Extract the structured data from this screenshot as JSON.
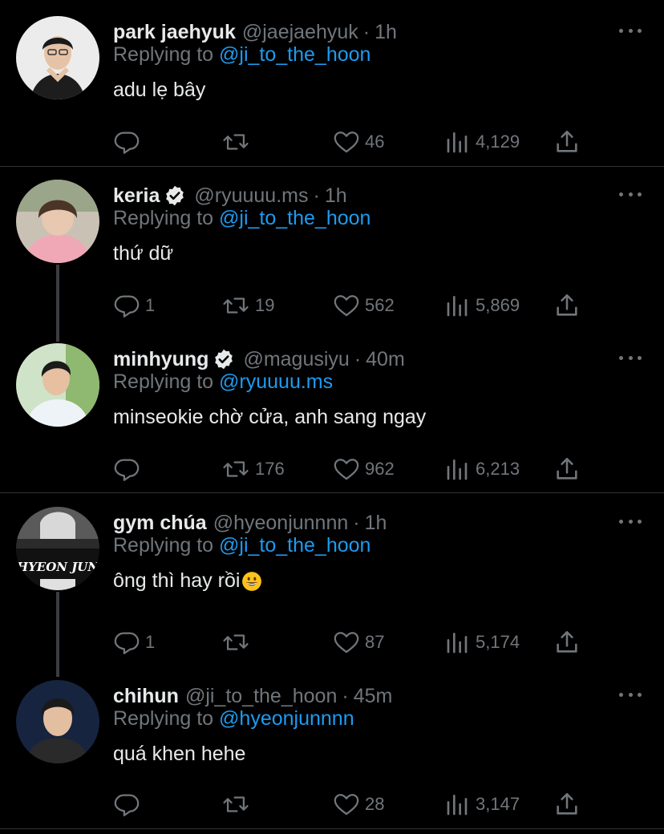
{
  "tweets": [
    {
      "name": "park jaehyuk",
      "verified": false,
      "handle": "@jaejaehyuk",
      "time": "1h",
      "replying_prefix": "Replying to",
      "replying_to": "@ji_to_the_hoon",
      "text": "adu lẹ bây",
      "replies": "",
      "retweets": "",
      "likes": "46",
      "views": "4,129"
    },
    {
      "name": "keria",
      "verified": true,
      "handle": "@ryuuuu.ms",
      "time": "1h",
      "replying_prefix": "Replying to",
      "replying_to": "@ji_to_the_hoon",
      "text": "thứ dữ",
      "replies": "1",
      "retweets": "19",
      "likes": "562",
      "views": "5,869"
    },
    {
      "name": "minhyung",
      "verified": true,
      "handle": "@magusiyu",
      "time": "40m",
      "replying_prefix": "Replying to",
      "replying_to": "@ryuuuu.ms",
      "text": "minseokie chờ cửa, anh sang ngay",
      "replies": "",
      "retweets": "176",
      "likes": "962",
      "views": "6,213"
    },
    {
      "name": "gym chúa",
      "verified": false,
      "handle": "@hyeonjunnnn",
      "time": "1h",
      "replying_prefix": "Replying to",
      "replying_to": "@ji_to_the_hoon",
      "text": "ông thì hay rồi",
      "replies": "1",
      "retweets": "",
      "likes": "87",
      "views": "5,174"
    },
    {
      "name": "chihun",
      "verified": false,
      "handle": "@ji_to_the_hoon",
      "time": "45m",
      "replying_prefix": "Replying to",
      "replying_to": "@hyeonjunnnn",
      "text": "quá khen hehe",
      "replies": "",
      "retweets": "",
      "likes": "28",
      "views": "3,147"
    }
  ],
  "separator": "·",
  "avatar4_text": "HYEON JUN",
  "colors": {
    "accent": "#1d9bf0",
    "muted": "#71767b",
    "text": "#e7e9ea",
    "bg": "#000000",
    "divider": "#2f3336"
  }
}
